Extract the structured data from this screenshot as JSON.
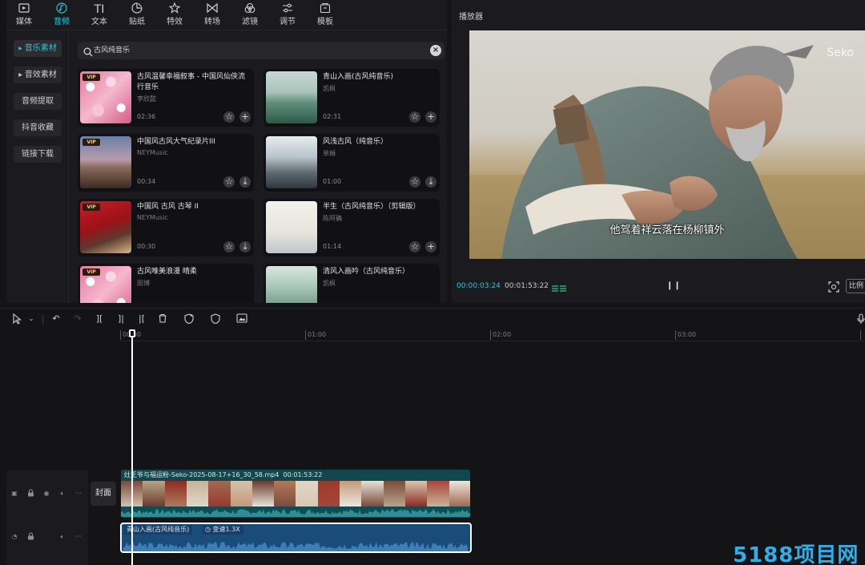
{
  "toolbar": {
    "tabs": [
      {
        "label": "媒体",
        "icon": "media-icon"
      },
      {
        "label": "音频",
        "icon": "audio-icon",
        "active": true
      },
      {
        "label": "文本",
        "icon": "text-icon"
      },
      {
        "label": "贴纸",
        "icon": "sticker-icon"
      },
      {
        "label": "特效",
        "icon": "effects-icon"
      },
      {
        "label": "转场",
        "icon": "transition-icon"
      },
      {
        "label": "滤镜",
        "icon": "filter-icon"
      },
      {
        "label": "调节",
        "icon": "adjust-icon"
      },
      {
        "label": "模板",
        "icon": "template-icon"
      }
    ],
    "text_icon_glyph": "TI"
  },
  "sidebar": {
    "items": [
      {
        "label": "音乐素材",
        "active": true,
        "expandable": true
      },
      {
        "label": "音效素材",
        "expandable": true
      },
      {
        "label": "音频提取"
      },
      {
        "label": "抖音收藏"
      },
      {
        "label": "链接下载"
      }
    ]
  },
  "search": {
    "value": "古风纯音乐"
  },
  "vip_badge": "VIP",
  "music": [
    {
      "title": "古风温馨幸福叙事 - 中国风仙侠流行音乐",
      "artist": "李欣懿",
      "duration": "02:36",
      "vip": true,
      "action": "add"
    },
    {
      "title": "青山入画(古风纯音乐)",
      "artist": "凯枫",
      "duration": "02:31",
      "vip": false,
      "action": "add"
    },
    {
      "title": "中国风古风大气纪录片III",
      "artist": "NEYMusic",
      "duration": "00:34",
      "vip": true,
      "action": "download"
    },
    {
      "title": "风浅古风（纯音乐）",
      "artist": "单楫",
      "duration": "01:00",
      "vip": false,
      "action": "download"
    },
    {
      "title": "中国风 古风 古琴 II",
      "artist": "NEYMusic",
      "duration": "00:30",
      "vip": true,
      "action": "download"
    },
    {
      "title": "半生（古风纯音乐）（剪辑版）",
      "artist": "陈阿确",
      "duration": "01:14",
      "vip": false,
      "action": "add"
    },
    {
      "title": "古风唯美浪漫 晴柔",
      "artist": "田博",
      "duration": "",
      "vip": true,
      "action": ""
    },
    {
      "title": "清风入画吟（古风纯音乐）",
      "artist": "凯枫",
      "duration": "",
      "vip": false,
      "action": ""
    }
  ],
  "player": {
    "title": "播放器",
    "watermark": "Seko",
    "subtitle": "他驾着祥云落在杨柳镇外",
    "current_time": "00:00:03:24",
    "total_time": "00:01:53:22",
    "ratio_label": "比例"
  },
  "timeline": {
    "ruler": [
      "00:00",
      "01:00",
      "02:00",
      "03:00"
    ],
    "cover_label": "封面",
    "video_clip": {
      "name": "灶王爷与福运粉-Seko-2025-08-17+16_30_58.mp4",
      "duration": "00:01:53:22"
    },
    "audio_clip": {
      "name": "青山入画(古风纯音乐)",
      "speed": "变速1.3X"
    },
    "playhead_time_fraction_of_first_minute": 0.0
  },
  "site_watermark": "5188项目网",
  "colors": {
    "accent": "#25c8d6",
    "video_clip": "#0f5d64",
    "audio_clip": "#1a4c7a"
  }
}
